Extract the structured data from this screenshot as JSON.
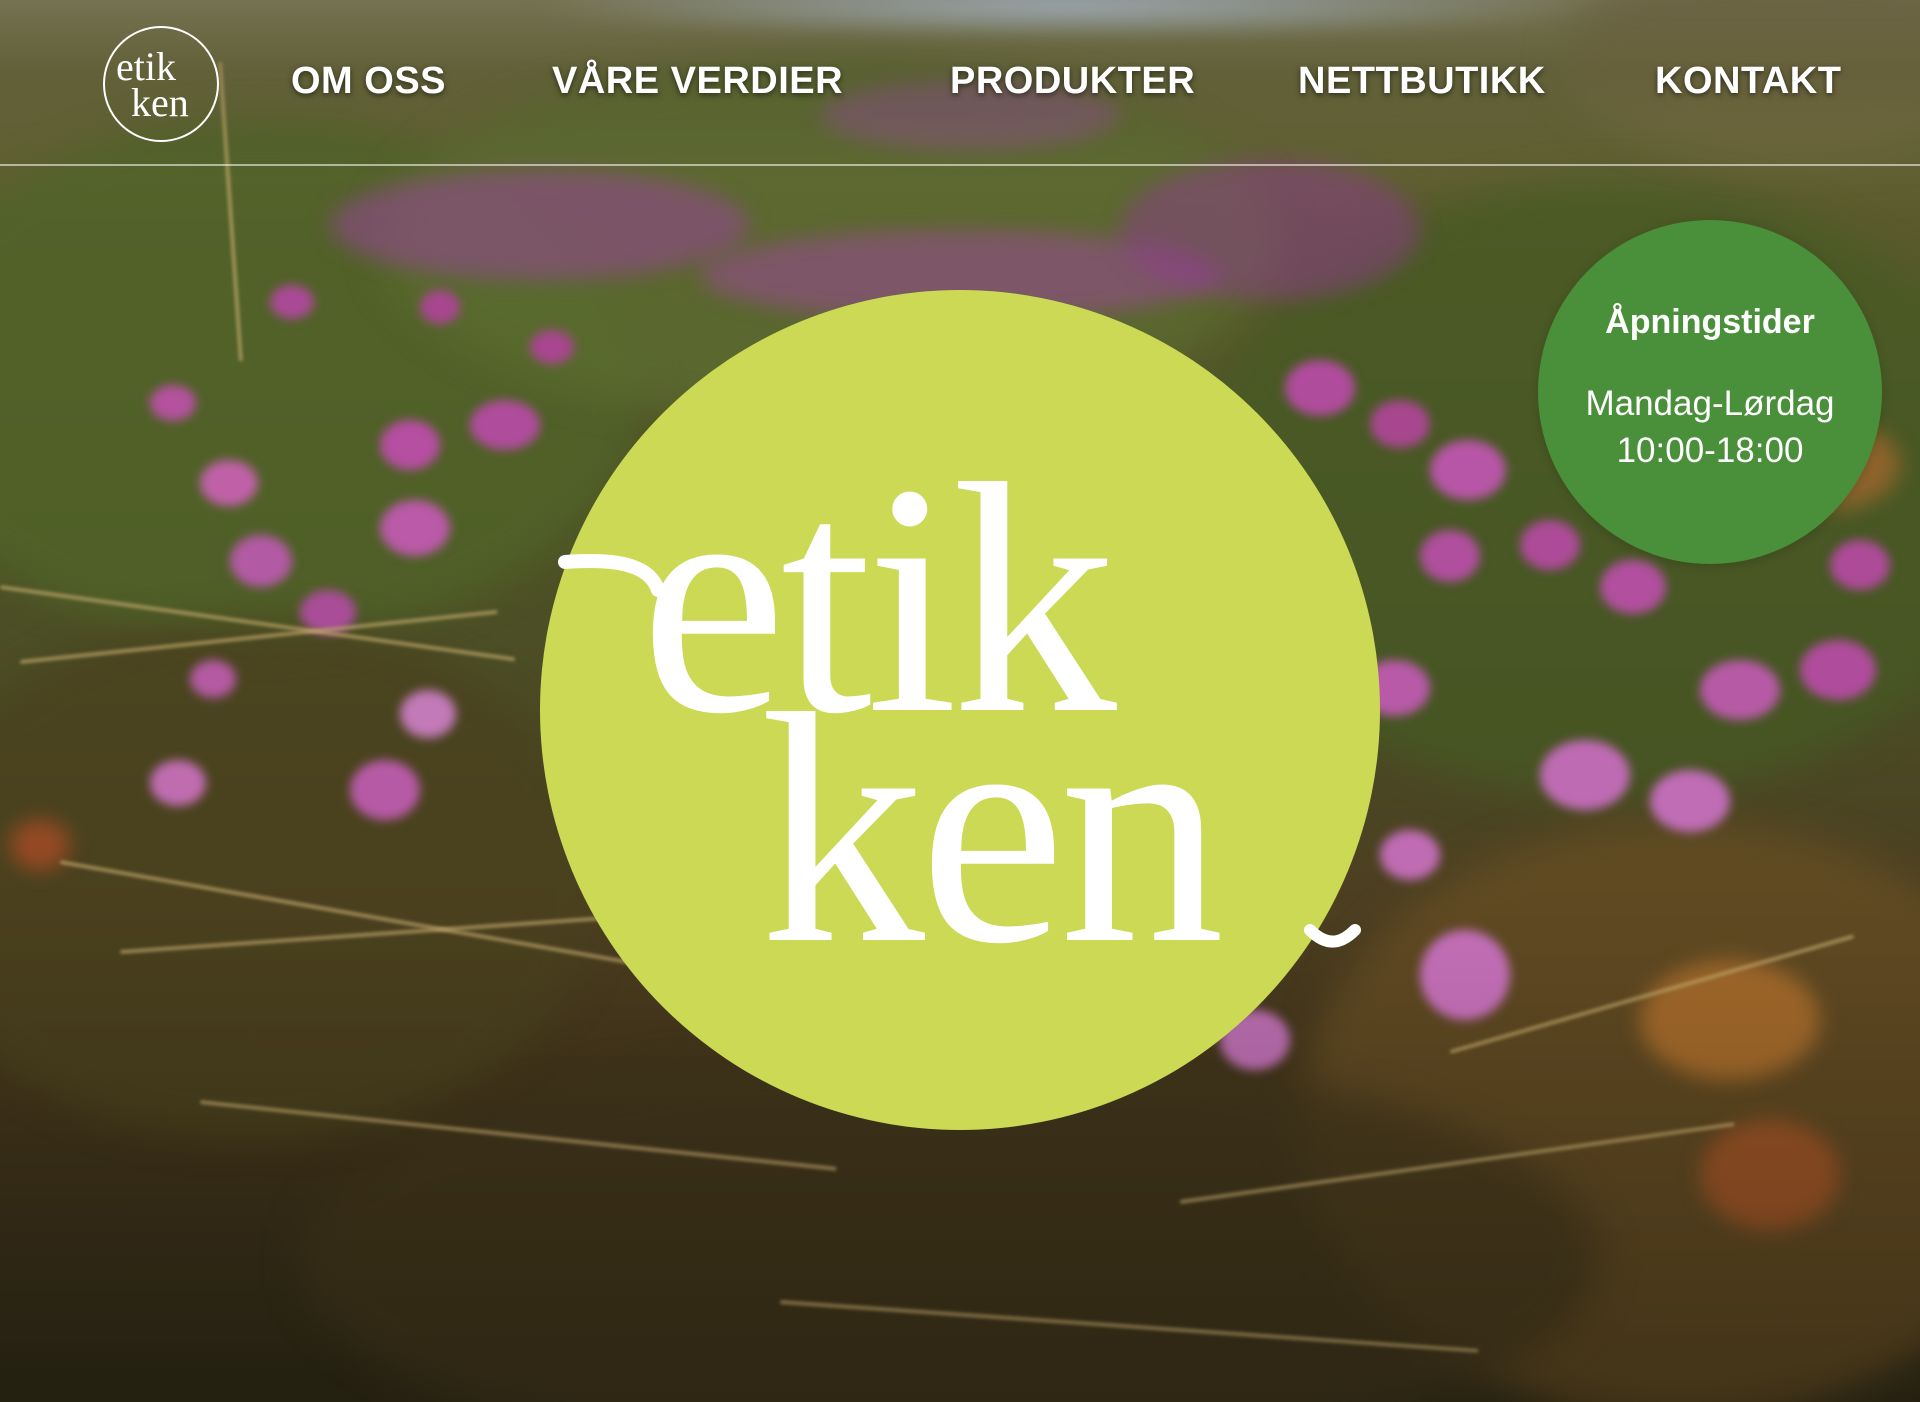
{
  "brand": {
    "name": "etikken",
    "logo_line1": "etik",
    "logo_line2": "ken",
    "logo_circle_color": "#cbd955",
    "logo_text_color": "#ffffff"
  },
  "nav": {
    "items": [
      {
        "label": "OM OSS"
      },
      {
        "label": "VÅRE VERDIER"
      },
      {
        "label": "PRODUKTER"
      },
      {
        "label": "NETTBUTIKK"
      },
      {
        "label": "KONTAKT"
      }
    ]
  },
  "opening_hours": {
    "title": "Åpningstider",
    "days": "Mandag-Lørdag",
    "time": "10:00-18:00",
    "badge_color": "#4a8f3a"
  },
  "hero": {
    "background": "blurred meadow with purple moss campion flowers"
  }
}
